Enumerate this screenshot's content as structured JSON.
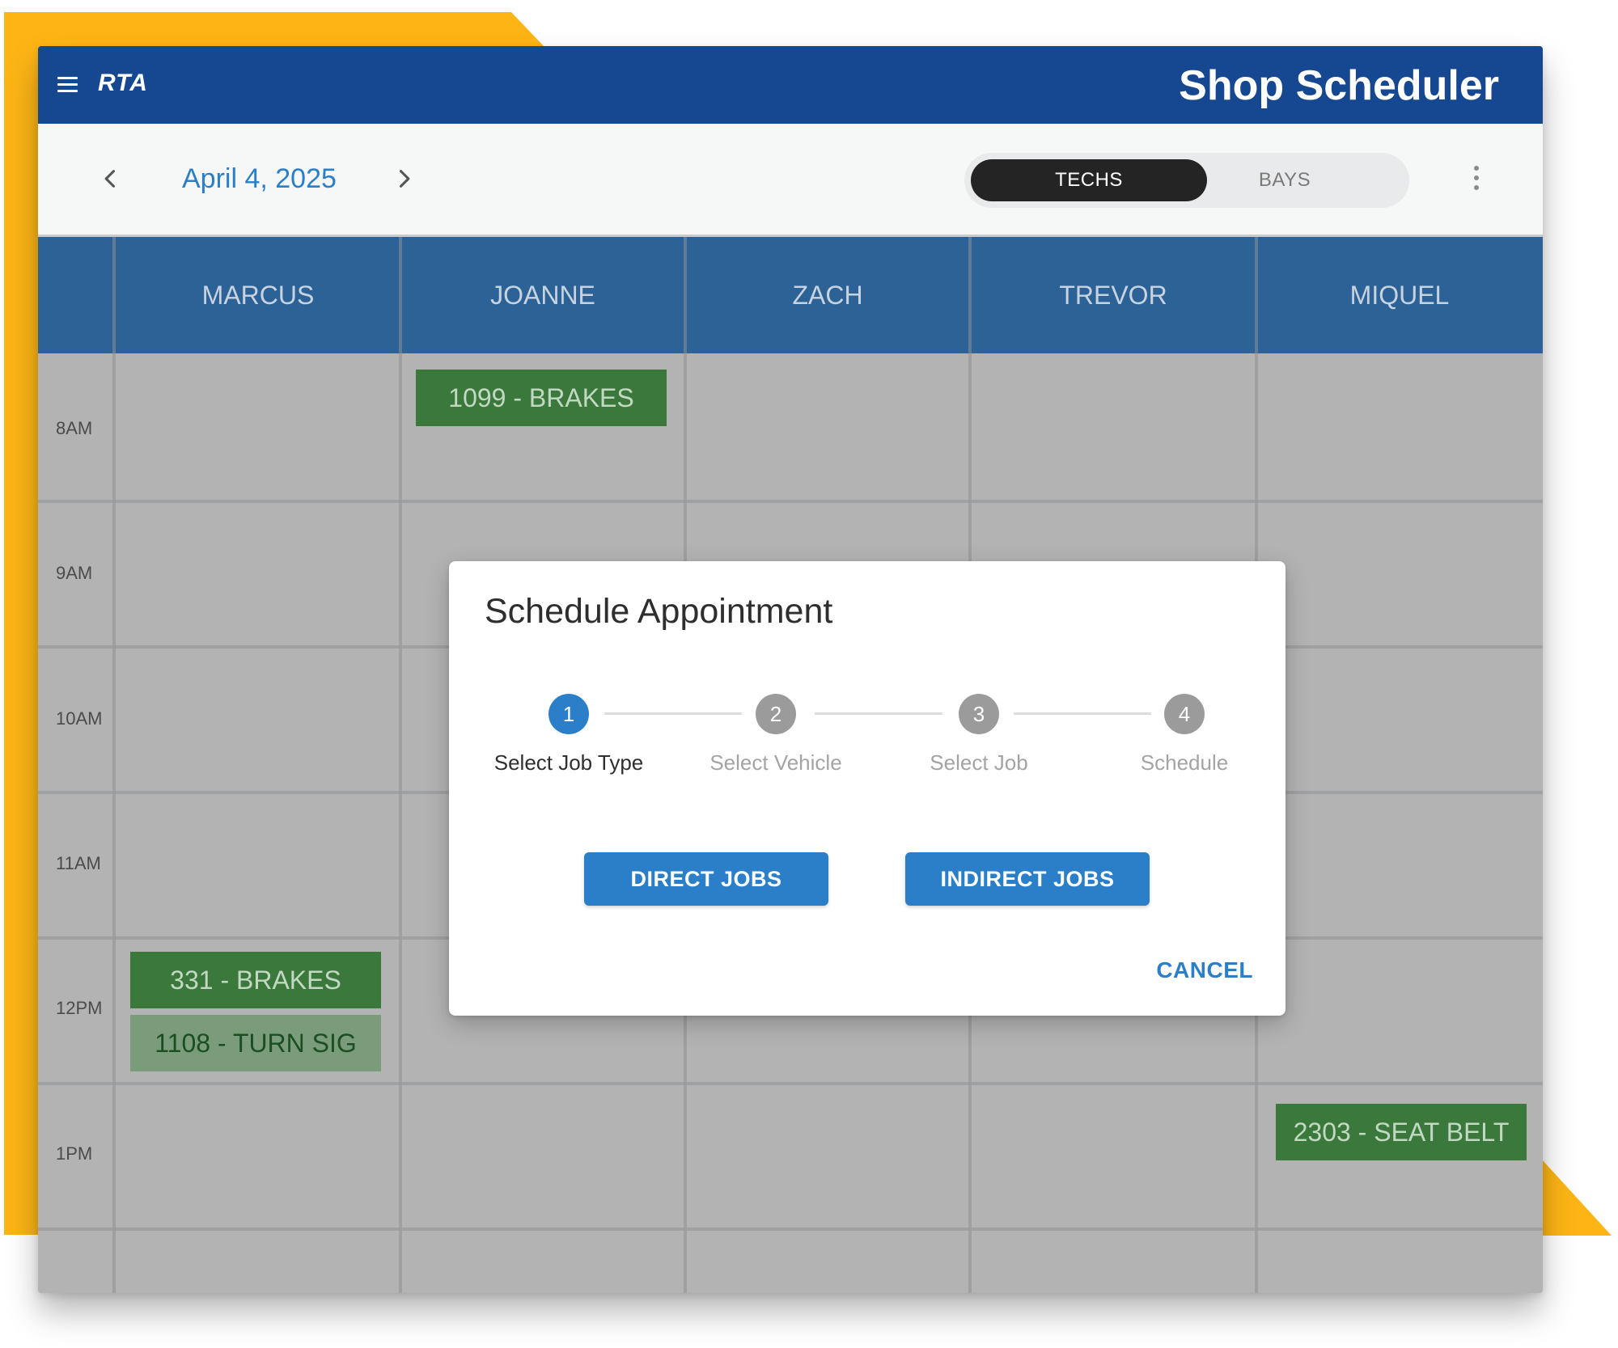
{
  "header": {
    "logo": "RTA",
    "title": "Shop Scheduler"
  },
  "toolbar": {
    "date": "April 4, 2025",
    "view_toggle": {
      "options": [
        "TECHS",
        "BAYS"
      ],
      "selected": "TECHS"
    }
  },
  "schedule": {
    "techs": [
      "MARCUS",
      "JOANNE",
      "ZACH",
      "TREVOR",
      "MIQUEL"
    ],
    "times": [
      "8AM",
      "9AM",
      "10AM",
      "11AM",
      "12PM",
      "1PM"
    ],
    "jobs": [
      {
        "tech": "JOANNE",
        "time": "8AM",
        "label": "1099 - BRAKES"
      },
      {
        "tech": "MARCUS",
        "time": "12PM",
        "label": "331 - BRAKES"
      },
      {
        "tech": "MARCUS",
        "time": "12PM",
        "label": "1108 - TURN SIG"
      },
      {
        "tech": "MIQUEL",
        "time": "1PM",
        "label": "2303 - SEAT BELT"
      }
    ]
  },
  "dialog": {
    "title": "Schedule Appointment",
    "steps": [
      {
        "number": "1",
        "label": "Select Job Type",
        "active": true
      },
      {
        "number": "2",
        "label": "Select Vehicle",
        "active": false
      },
      {
        "number": "3",
        "label": "Select Job",
        "active": false
      },
      {
        "number": "4",
        "label": "Schedule",
        "active": false
      }
    ],
    "buttons": {
      "direct": "DIRECT JOBS",
      "indirect": "INDIRECT JOBS",
      "cancel": "CANCEL"
    }
  },
  "colors": {
    "brand_blue": "#164891",
    "accent_yellow": "#fdb515",
    "primary": "#2b7fc9",
    "job_green": "#3a793b",
    "job_green_light": "#7a9c7b"
  },
  "icons": {
    "menu": "hamburger-menu-icon",
    "prev": "chevron-left-icon",
    "next": "chevron-right-icon",
    "more": "more-vertical-icon"
  }
}
